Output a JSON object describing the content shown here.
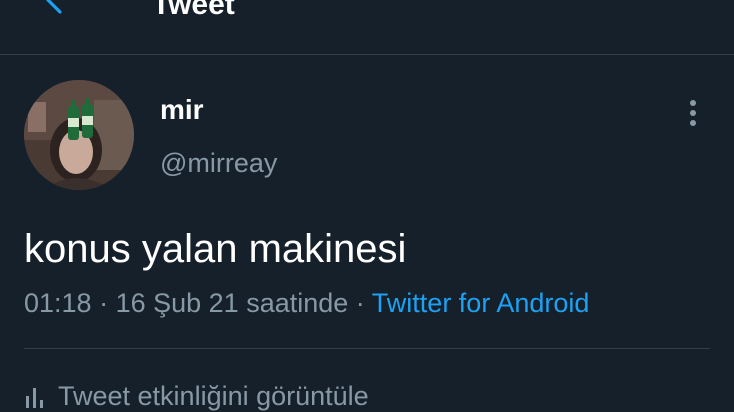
{
  "header": {
    "title": "Tweet",
    "back_icon": "arrow-left-icon"
  },
  "author": {
    "display_name": "mir",
    "username": "@mirreay",
    "avatar": "profile-photo"
  },
  "tweet": {
    "text": "konus yalan makinesi",
    "time": "01:18",
    "date": "16 Şub 21 saatinde",
    "separator": " · ",
    "source": "Twitter for Android"
  },
  "actions": {
    "more_icon": "more-vertical-icon",
    "activity_label": "Tweet etkinliğini görüntüle",
    "activity_icon": "bar-chart-icon"
  },
  "colors": {
    "background": "#15202b",
    "primary_text": "#ffffff",
    "secondary_text": "#8899a6",
    "accent": "#1da1f2",
    "divider": "#2f3c4a"
  }
}
